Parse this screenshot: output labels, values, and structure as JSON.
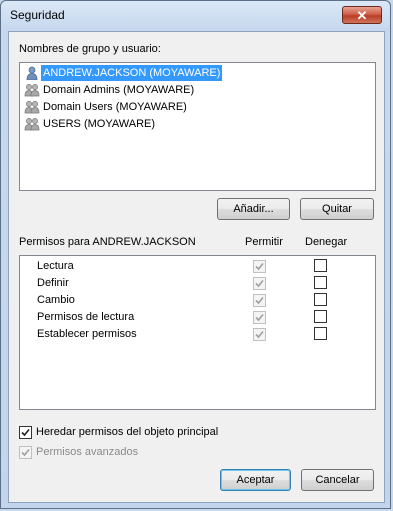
{
  "window": {
    "title": "Seguridad",
    "close_label": "✕"
  },
  "groups_label": "Nombres de grupo y usuario:",
  "principals": [
    {
      "name": "ANDREW.JACKSON (MOYAWARE)",
      "icon": "user-icon",
      "selected": true
    },
    {
      "name": "Domain Admins (MOYAWARE)",
      "icon": "group-icon",
      "selected": false
    },
    {
      "name": "Domain Users (MOYAWARE)",
      "icon": "group-icon",
      "selected": false
    },
    {
      "name": "USERS (MOYAWARE)",
      "icon": "group-icon",
      "selected": false
    }
  ],
  "buttons": {
    "add": "Añadir...",
    "remove": "Quitar",
    "accept": "Aceptar",
    "cancel": "Cancelar"
  },
  "permissions_header": {
    "for_label": "Permisos para ANDREW.JACKSON",
    "allow": "Permitir",
    "deny": "Denegar"
  },
  "permissions": [
    {
      "name": "Lectura",
      "allow": true,
      "deny": false
    },
    {
      "name": "Definir",
      "allow": true,
      "deny": false
    },
    {
      "name": "Cambio",
      "allow": true,
      "deny": false
    },
    {
      "name": "Permisos de lectura",
      "allow": true,
      "deny": false
    },
    {
      "name": "Establecer permisos",
      "allow": true,
      "deny": false
    }
  ],
  "inherit": {
    "label": "Heredar permisos del objeto principal",
    "checked": true
  },
  "advanced": {
    "label": "Permisos avanzados",
    "checked": true,
    "disabled": true
  },
  "colors": {
    "selection": "#3399ff",
    "window_frame": "#c9d9ec",
    "close_button": "#c94a34"
  }
}
